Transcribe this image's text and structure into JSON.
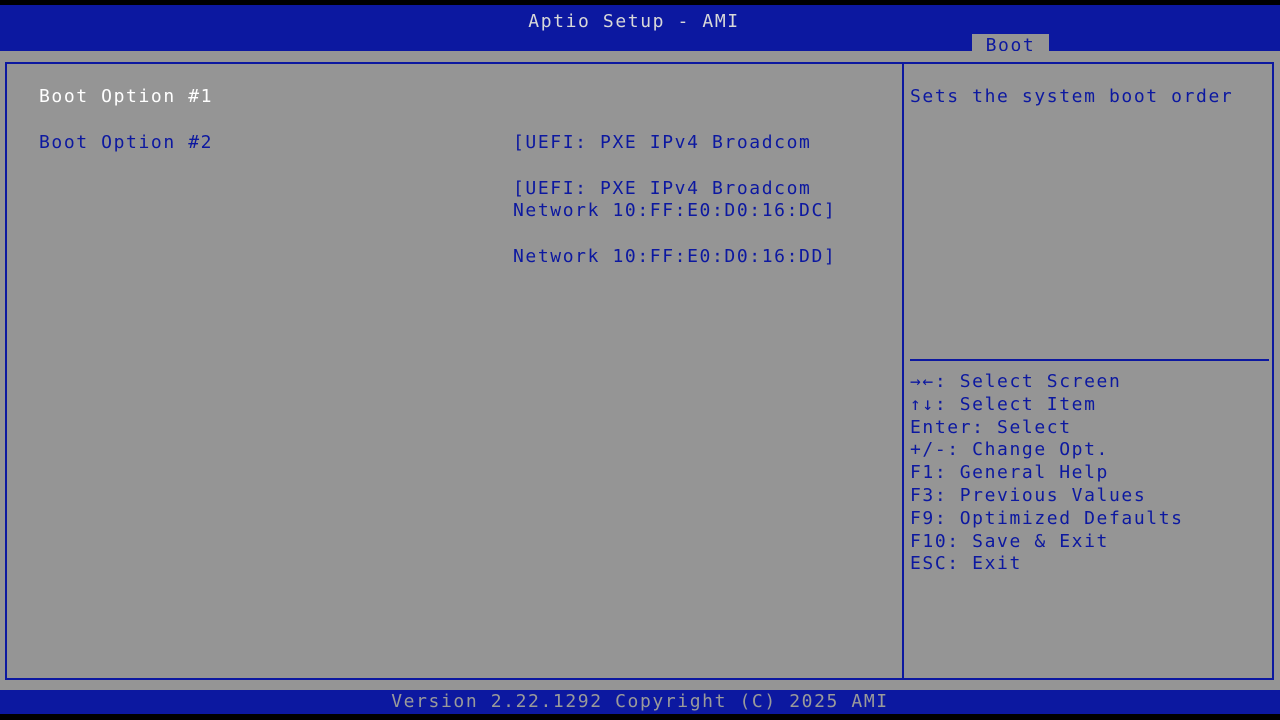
{
  "header": {
    "title": "Aptio Setup - AMI",
    "active_tab": "Boot"
  },
  "boot_options": [
    {
      "label": "Boot Option #1",
      "value_line1": "[UEFI: PXE IPv4 Broadcom",
      "value_line2": "Network 10:FF:E0:D0:16:DC]",
      "selected": true
    },
    {
      "label": "Boot Option #2",
      "value_line1": "[UEFI: PXE IPv4 Broadcom",
      "value_line2": "Network 10:FF:E0:D0:16:DD]",
      "selected": false
    }
  ],
  "help": {
    "description": "Sets the system boot order"
  },
  "key_legend": [
    "→←: Select Screen",
    "↑↓: Select Item",
    "Enter: Select",
    "+/-: Change Opt.",
    "F1: General Help",
    "F3: Previous Values",
    "F9: Optimized Defaults",
    "F10: Save & Exit",
    "ESC: Exit"
  ],
  "footer": {
    "version": "Version 2.22.1292 Copyright (C) 2025 AMI"
  },
  "colors": {
    "bios_blue": "#0c18a0",
    "panel_gray": "#959595",
    "selected_text": "#ffffff",
    "title_text": "#d8d8d8",
    "footer_text": "#9a9a9a"
  }
}
